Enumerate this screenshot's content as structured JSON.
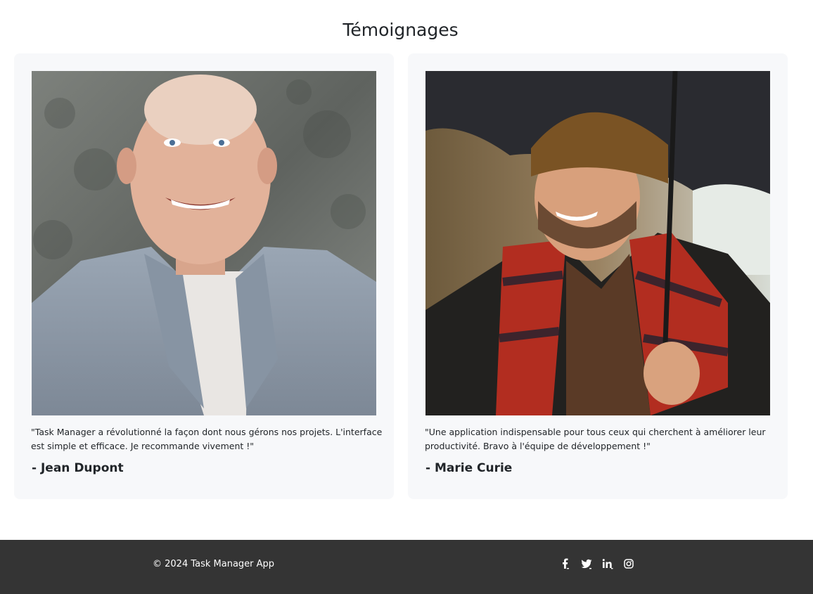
{
  "section": {
    "title": "Témoignages"
  },
  "testimonials": [
    {
      "quote": "\"Task Manager a révolutionné la façon dont nous gérons nos projets. L'interface est simple et efficace. Je recommande vivement !\"",
      "author": "- Jean Dupont",
      "photo_icon": "portrait-photo"
    },
    {
      "quote": "\"Une application indispensable pour tous ceux qui cherchent à améliorer leur productivité. Bravo à l'équipe de développement !\"",
      "author": "- Marie Curie",
      "photo_icon": "portrait-photo"
    }
  ],
  "footer": {
    "copyright": "© 2024 Task Manager App",
    "social_icons": [
      "facebook-icon",
      "twitter-icon",
      "linkedin-icon",
      "instagram-icon"
    ]
  },
  "colors": {
    "card_bg": "#f7f8fa",
    "footer_bg": "#343434",
    "text": "#212529"
  }
}
